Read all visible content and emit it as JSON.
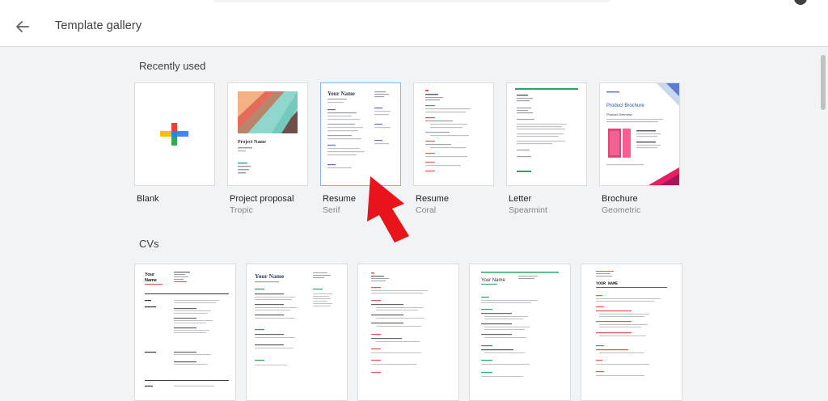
{
  "header": {
    "title": "Template gallery"
  },
  "sections": {
    "recent_title": "Recently used",
    "cvs_title": "CVs"
  },
  "recent": [
    {
      "name": "Blank",
      "sub": ""
    },
    {
      "name": "Project proposal",
      "sub": "Tropic"
    },
    {
      "name": "Resume",
      "sub": "Serif"
    },
    {
      "name": "Resume",
      "sub": "Coral"
    },
    {
      "name": "Letter",
      "sub": "Spearmint"
    },
    {
      "name": "Brochure",
      "sub": "Geometric"
    }
  ],
  "thumbnails": {
    "project_title": "Project Name",
    "serif_name": "Your Name",
    "brochure_title": "Product Brochure",
    "brochure_sub": "Product Overview",
    "cv1_name_line1": "Your",
    "cv1_name_line2": "Name",
    "cv2_name": "Your Name",
    "cv4_name": "Your Name",
    "cv5_name": "YOUR NAME"
  },
  "colors": {
    "arrow": "#e8131b",
    "selected_border": "#8ab4f8",
    "coral": "#e4574c",
    "spearmint": "#25a55f"
  }
}
